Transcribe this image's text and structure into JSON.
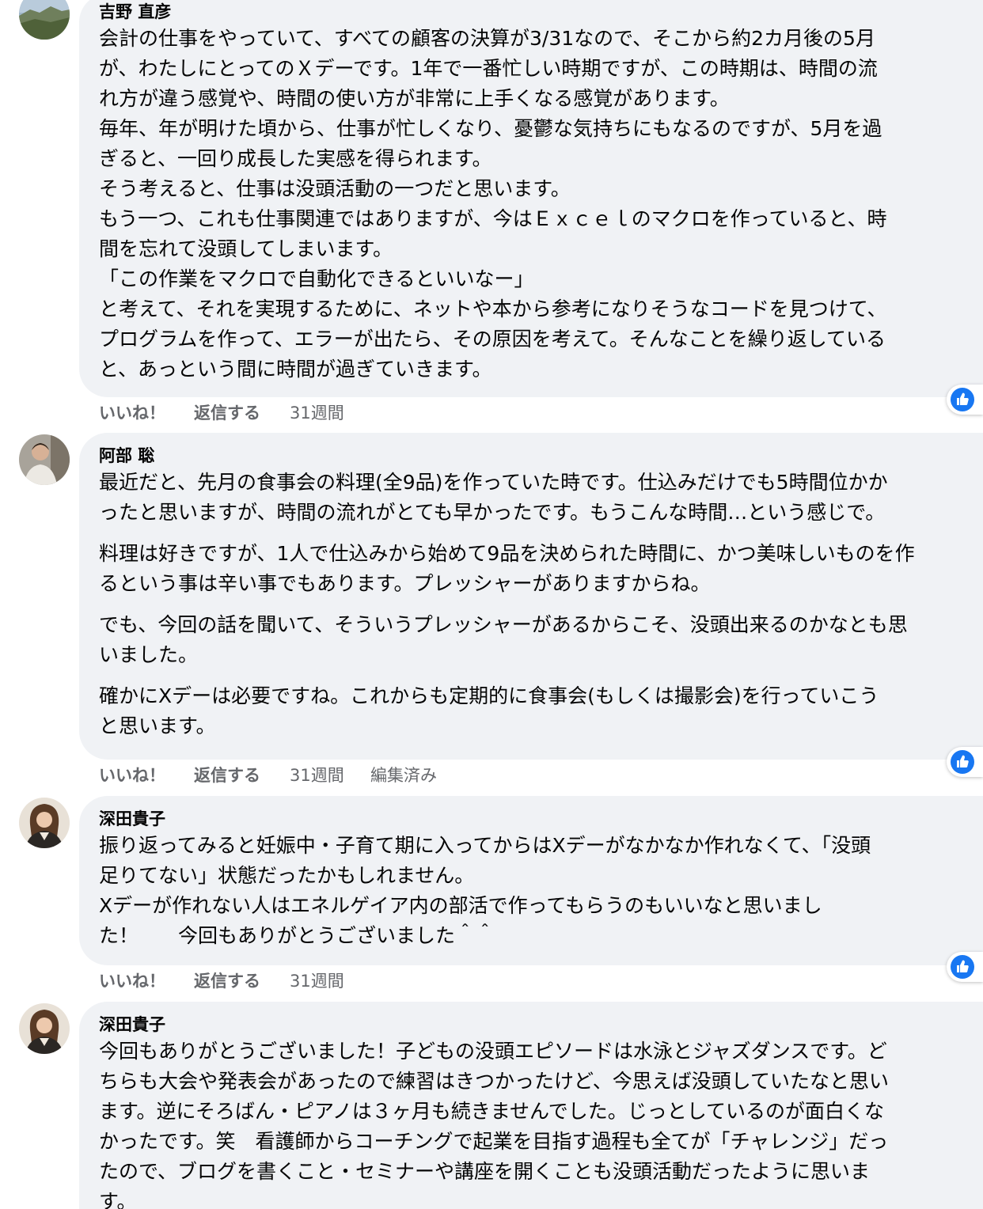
{
  "comments": [
    {
      "author": "吉野 直彦",
      "paragraphs": [
        [
          "会計の仕事をやっていて、すべての顧客の決算が3/31なので、そこから約2カ月後の5月",
          "が、わたしにとってのＸデーです。1年で一番忙しい時期ですが、この時期は、時間の流",
          "れ方が違う感覚や、時間の使い方が非常に上手くなる感覚があります。",
          "毎年、年が明けた頃から、仕事が忙しくなり、憂鬱な気持ちにもなるのですが、5月を過",
          "ぎると、一回り成長した実感を得られます。",
          "そう考えると、仕事は没頭活動の一つだと思います。",
          "もう一つ、これも仕事関連ではありますが、今はＥｘｃｅｌのマクロを作っていると、時",
          "間を忘れて没頭してしまいます。",
          "「この作業をマクロで自動化できるといいなー」",
          "と考えて、それを実現するために、ネットや本から参考になりそうなコードを見つけて、",
          "プログラムを作って、エラーが出たら、その原因を考えて。そんなことを繰り返している",
          "と、あっという間に時間が過ぎていきます。"
        ]
      ],
      "actions": {
        "like": "いいね！",
        "reply": "返信する",
        "time": "31週間",
        "edited": ""
      }
    },
    {
      "author": "阿部 聡",
      "paragraphs": [
        [
          "最近だと、先月の食事会の料理(全9品)を作っていた時です。仕込みだけでも5時間位かか",
          "ったと思いますが、時間の流れがとても早かったです。もうこんな時間…という感じで。"
        ],
        [
          "料理は好きですが、1人で仕込みから始めて9品を決められた時間に、かつ美味しいものを作",
          "るという事は辛い事でもあります。プレッシャーがありますからね。"
        ],
        [
          "でも、今回の話を聞いて、そういうプレッシャーがあるからこそ、没頭出来るのかなとも思",
          "いました。"
        ],
        [
          "確かにXデーは必要ですね。これからも定期的に食事会(もしくは撮影会)を行っていこう",
          "と思います。"
        ]
      ],
      "actions": {
        "like": "いいね！",
        "reply": "返信する",
        "time": "31週間",
        "edited": "編集済み"
      }
    },
    {
      "author": "深田貴子",
      "paragraphs": [
        [
          "振り返ってみると妊娠中・子育て期に入ってからはXデーがなかなか作れなくて、「没頭",
          "足りてない」状態だったかもしれません。",
          "Xデーが作れない人はエネルゲイア内の部活で作ってもらうのもいいなと思いまし",
          "た！　　今回もありがとうございました＾＾"
        ]
      ],
      "actions": {
        "like": "いいね！",
        "reply": "返信する",
        "time": "31週間",
        "edited": ""
      }
    },
    {
      "author": "深田貴子",
      "paragraphs": [
        [
          "今回もありがとうございました！子どもの没頭エピソードは水泳とジャズダンスです。ど",
          "ちらも大会や発表会があったので練習はきつかったけど、今思えば没頭していたなと思い",
          "ます。逆にそろばん・ピアノは３ヶ月も続きませんでした。じっとしているのが面白くな",
          "かったです。笑　看護師からコーチングで起業を目指す過程も全てが「チャレンジ」だっ",
          "たので、ブログを書くこと・セミナーや講座を開くことも没頭活動だったように思いま",
          "す。"
        ]
      ],
      "actions": null
    }
  ],
  "icons": {
    "like_reaction": "thumbs-up-icon",
    "avatar": "profile-photo"
  },
  "colors": {
    "bubble": "#f0f2f5",
    "text": "#050505",
    "meta": "#65676b",
    "like_blue": "#1877f2"
  }
}
